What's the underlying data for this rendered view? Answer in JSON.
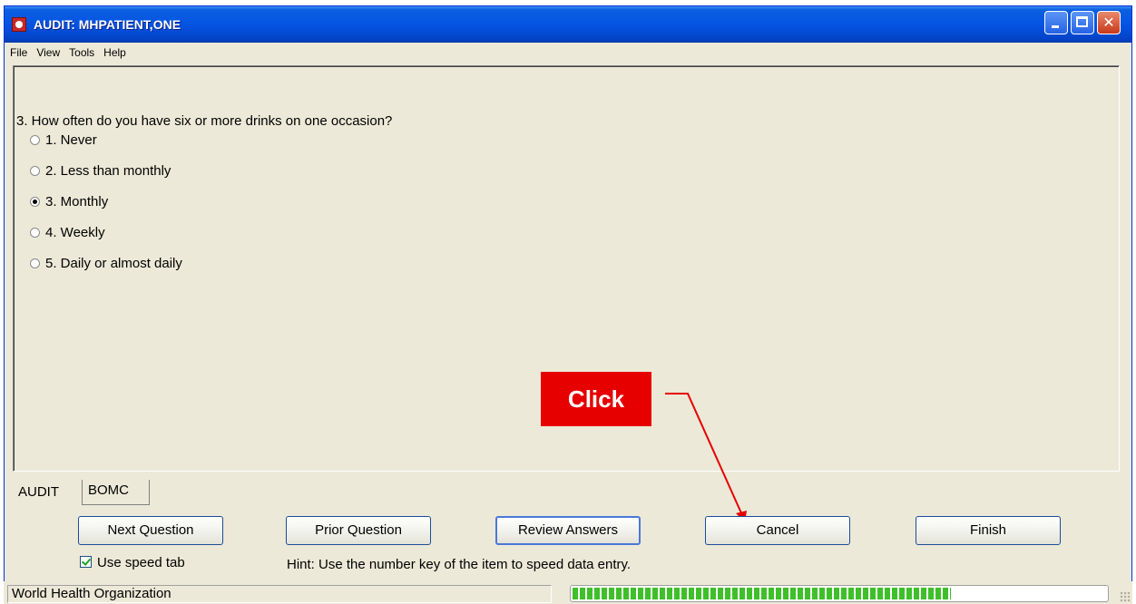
{
  "window": {
    "title": "AUDIT: MHPATIENT,ONE"
  },
  "menu": [
    "File",
    "View",
    "Tools",
    "Help"
  ],
  "question": {
    "text": "3. How often do you have six or more drinks on one occasion?",
    "options": [
      {
        "label": "1. Never",
        "selected": false
      },
      {
        "label": "2. Less than monthly",
        "selected": false
      },
      {
        "label": "3. Monthly",
        "selected": true
      },
      {
        "label": "4. Weekly",
        "selected": false
      },
      {
        "label": "5. Daily or almost daily",
        "selected": false
      }
    ]
  },
  "callout": {
    "label": "Click",
    "color": "#e60000"
  },
  "tabs": [
    {
      "label": "AUDIT",
      "active": true
    },
    {
      "label": "BOMC",
      "active": false
    }
  ],
  "buttons": {
    "next": "Next Question",
    "prior": "Prior Question",
    "review": "Review Answers",
    "cancel": "Cancel",
    "finish": "Finish"
  },
  "speed_tab": {
    "label": "Use speed tab",
    "checked": true
  },
  "hint": "Hint: Use the number key of the item to speed data entry.",
  "status": {
    "left": "World Health Organization",
    "progress": 0.71
  },
  "colors": {
    "titlebar": "#0554e3",
    "window_bg": "#ece9d8",
    "progress": "#3fbf2a"
  }
}
